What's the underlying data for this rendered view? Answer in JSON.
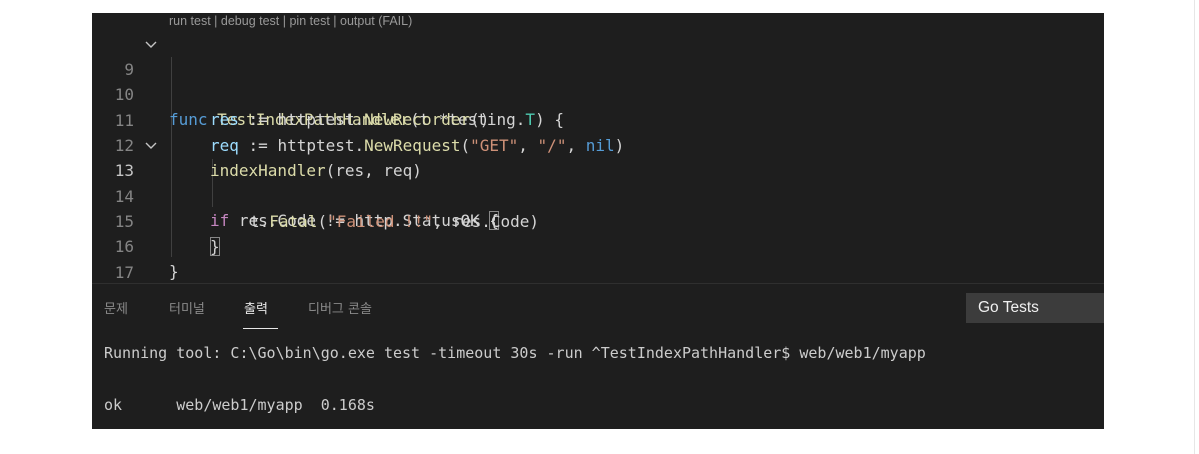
{
  "codelens": {
    "run_test": "run test",
    "debug_test": "debug test",
    "pin_test": "pin test",
    "output": "output (FAIL)",
    "sep": " | "
  },
  "lines": [
    {
      "num": "9"
    },
    {
      "num": "10"
    },
    {
      "num": "11"
    },
    {
      "num": "12"
    },
    {
      "num": "13"
    },
    {
      "num": "14"
    },
    {
      "num": "15"
    },
    {
      "num": "16"
    },
    {
      "num": "17"
    }
  ],
  "code": {
    "l9": {
      "func": "func",
      "name": "TestIndexPathHandler",
      "rest1": "(t *testing.",
      "type": "T",
      "rest2": ") {"
    },
    "l10": {
      "res": "res",
      "op": " := httptest.",
      "fn": "NewRecorder",
      "rest": "()"
    },
    "l11": {
      "req": "req",
      "op": " := httptest.",
      "fn": "NewRequest",
      "p1": "(",
      "s1": "\"GET\"",
      "c": ", ",
      "s2": "\"/\"",
      "c2": ", ",
      "nil": "nil",
      "p2": ")"
    },
    "l12": {
      "fn": "indexHandler",
      "rest": "(res, req)"
    },
    "l13": {
      "if": "if",
      "rest": " res.Code != http.StatusOK ",
      "brace": "{"
    },
    "l14": {
      "pre": "t.",
      "fn": "Fatal",
      "p1": "(",
      "str": "\"Failed !!\"",
      "rest": ", res.Code)"
    },
    "l15": {
      "brace": "}"
    },
    "l16": {
      "brace": "}"
    }
  },
  "panel": {
    "tabs": [
      "문제",
      "터미널",
      "출력",
      "디버그 콘솔"
    ],
    "active_tab": "출력",
    "output_channel": "Go Tests",
    "output_lines": [
      "Running tool: C:\\Go\\bin\\go.exe test -timeout 30s -run ^TestIndexPathHandler$ web/web1/myapp",
      "ok      web/web1/myapp  0.168s"
    ]
  }
}
